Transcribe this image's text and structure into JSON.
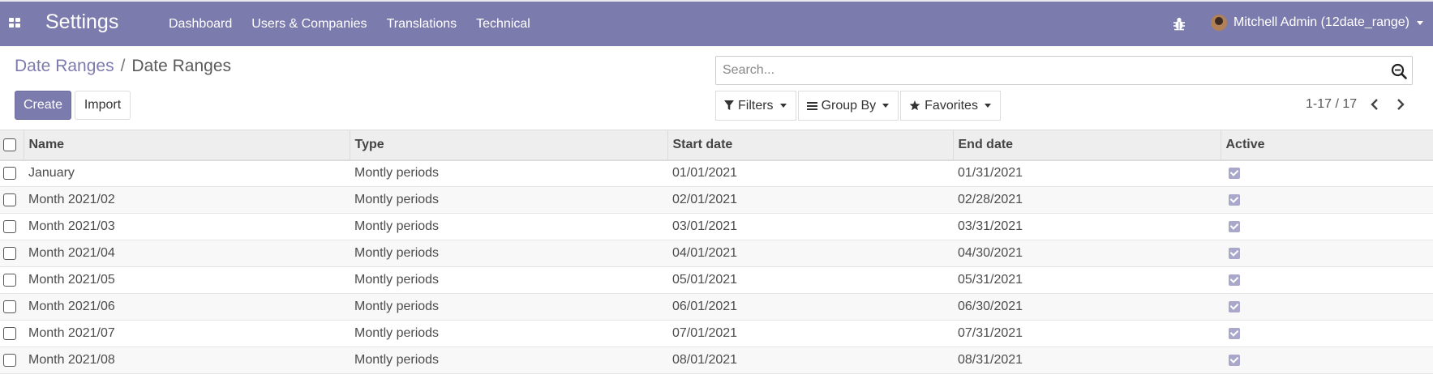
{
  "topbar": {
    "app_title": "Settings",
    "menu": [
      "Dashboard",
      "Users & Companies",
      "Translations",
      "Technical"
    ],
    "user_name": "Mitchell Admin (12date_range)",
    "accent_color": "#7c7bad"
  },
  "breadcrumb": {
    "parent": "Date Ranges",
    "separator": "/",
    "current": "Date Ranges"
  },
  "actions": {
    "create_label": "Create",
    "import_label": "Import"
  },
  "search": {
    "placeholder": "Search..."
  },
  "filters": {
    "filters_label": "Filters",
    "group_by_label": "Group By",
    "favorites_label": "Favorites"
  },
  "pager": {
    "text": "1-17 / 17"
  },
  "table": {
    "columns": [
      "Name",
      "Type",
      "Start date",
      "End date",
      "Active"
    ],
    "rows": [
      {
        "name": "January",
        "type": "Montly periods",
        "start": "01/01/2021",
        "end": "01/31/2021",
        "active": true
      },
      {
        "name": "Month 2021/02",
        "type": "Montly periods",
        "start": "02/01/2021",
        "end": "02/28/2021",
        "active": true
      },
      {
        "name": "Month 2021/03",
        "type": "Montly periods",
        "start": "03/01/2021",
        "end": "03/31/2021",
        "active": true
      },
      {
        "name": "Month 2021/04",
        "type": "Montly periods",
        "start": "04/01/2021",
        "end": "04/30/2021",
        "active": true
      },
      {
        "name": "Month 2021/05",
        "type": "Montly periods",
        "start": "05/01/2021",
        "end": "05/31/2021",
        "active": true
      },
      {
        "name": "Month 2021/06",
        "type": "Montly periods",
        "start": "06/01/2021",
        "end": "06/30/2021",
        "active": true
      },
      {
        "name": "Month 2021/07",
        "type": "Montly periods",
        "start": "07/01/2021",
        "end": "07/31/2021",
        "active": true
      },
      {
        "name": "Month 2021/08",
        "type": "Montly periods",
        "start": "08/01/2021",
        "end": "08/31/2021",
        "active": true
      }
    ]
  }
}
